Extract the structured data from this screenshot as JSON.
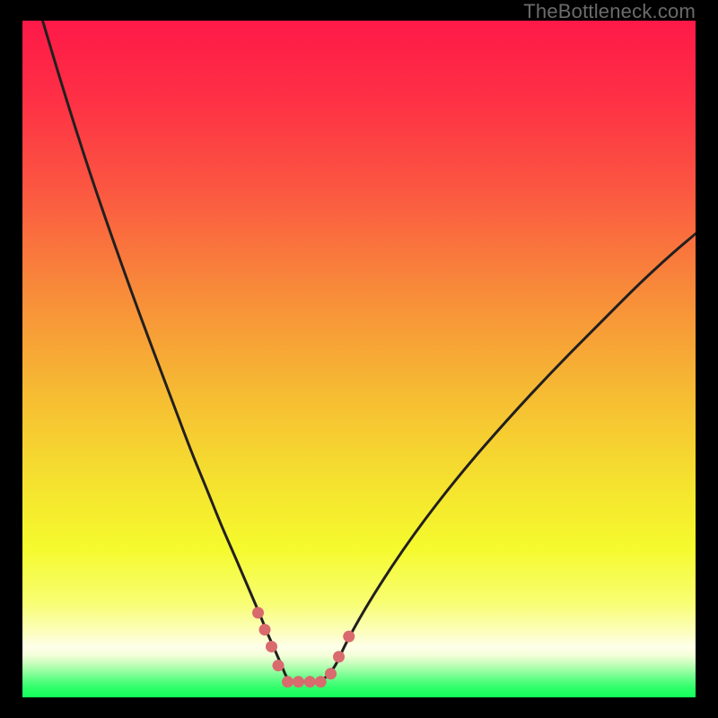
{
  "watermark": {
    "text": "TheBottleneck.com"
  },
  "colors": {
    "frame": "#000000",
    "curve": "#221f1f",
    "marker": "#d96a6e",
    "gradient_stops": [
      {
        "pct": 0.0,
        "color": "#fe1948"
      },
      {
        "pct": 0.12,
        "color": "#fe3145"
      },
      {
        "pct": 0.25,
        "color": "#fb5741"
      },
      {
        "pct": 0.4,
        "color": "#f88b3a"
      },
      {
        "pct": 0.55,
        "color": "#f6bb33"
      },
      {
        "pct": 0.68,
        "color": "#f5e12f"
      },
      {
        "pct": 0.78,
        "color": "#f5fa2d"
      },
      {
        "pct": 0.86,
        "color": "#f8fe72"
      },
      {
        "pct": 0.905,
        "color": "#fcfec0"
      },
      {
        "pct": 0.925,
        "color": "#feffe9"
      },
      {
        "pct": 0.938,
        "color": "#f3fed8"
      },
      {
        "pct": 0.95,
        "color": "#c7febc"
      },
      {
        "pct": 0.962,
        "color": "#94fea0"
      },
      {
        "pct": 0.974,
        "color": "#5cfe83"
      },
      {
        "pct": 0.986,
        "color": "#2efe6a"
      },
      {
        "pct": 1.0,
        "color": "#12fe5b"
      }
    ]
  },
  "chart_data": {
    "type": "line",
    "title": "",
    "xlabel": "",
    "ylabel": "",
    "xlim": [
      0,
      100
    ],
    "ylim": [
      0,
      100
    ],
    "grid": false,
    "legend": false,
    "annotations": [],
    "note": "x/y are in percent of plot-area; y=0 is the TOP edge so higher y values are lower on the canvas (the valley minimum is near y≈98).",
    "series": [
      {
        "name": "bottleneck-curve",
        "x": [
          3.0,
          6.0,
          10.0,
          14.0,
          18.0,
          22.0,
          25.0,
          27.5,
          29.5,
          31.5,
          33.0,
          34.3,
          35.5,
          36.5,
          37.5,
          38.5,
          39.5,
          42.0,
          44.5,
          46.5,
          48.0,
          52.0,
          58.0,
          65.0,
          72.0,
          79.0,
          86.0,
          92.0,
          97.0,
          100.0
        ],
        "y": [
          0.0,
          10.0,
          22.5,
          34.0,
          45.0,
          55.5,
          63.5,
          69.5,
          74.5,
          79.0,
          82.5,
          85.5,
          88.3,
          90.8,
          93.0,
          95.3,
          97.7,
          97.7,
          97.7,
          95.5,
          92.0,
          85.0,
          76.0,
          67.0,
          59.0,
          51.5,
          44.5,
          38.5,
          34.0,
          31.5
        ]
      }
    ],
    "markers": {
      "name": "valley-markers",
      "color": "#d96a6e",
      "radius_px": 6.5,
      "points": [
        {
          "x": 35.0,
          "y": 87.5
        },
        {
          "x": 36.0,
          "y": 90.0
        },
        {
          "x": 37.0,
          "y": 92.5
        },
        {
          "x": 38.0,
          "y": 95.3
        },
        {
          "x": 39.4,
          "y": 97.7
        },
        {
          "x": 41.0,
          "y": 97.7
        },
        {
          "x": 42.7,
          "y": 97.7
        },
        {
          "x": 44.3,
          "y": 97.7
        },
        {
          "x": 45.8,
          "y": 96.5
        },
        {
          "x": 47.0,
          "y": 94.0
        },
        {
          "x": 48.5,
          "y": 91.0
        }
      ]
    }
  }
}
